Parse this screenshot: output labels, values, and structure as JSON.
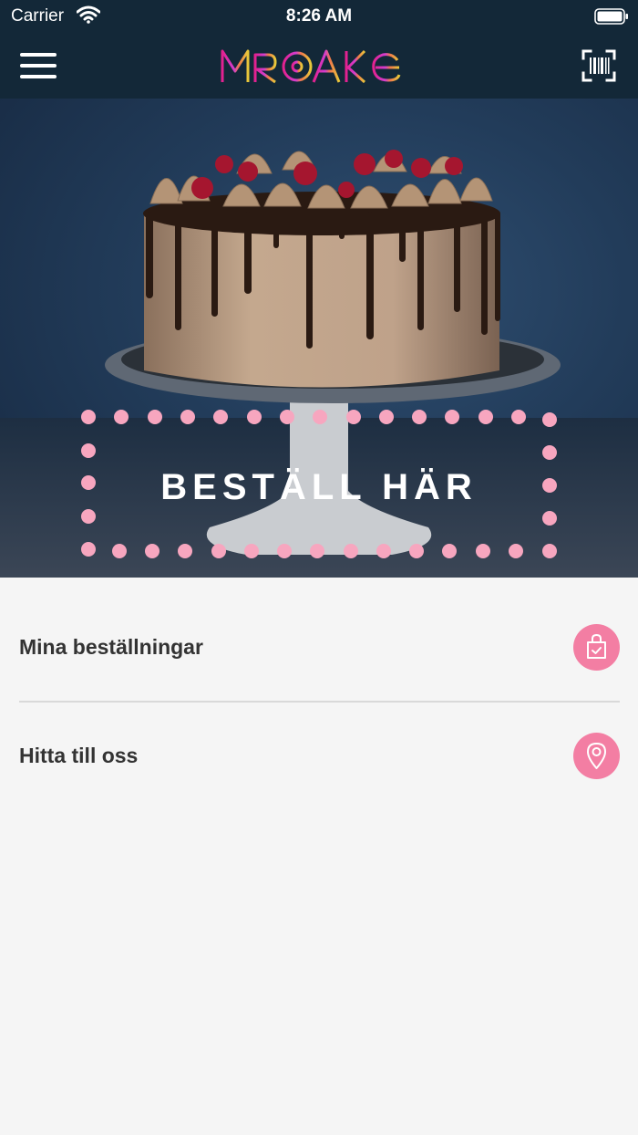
{
  "status_bar": {
    "carrier": "Carrier",
    "time": "8:26 AM"
  },
  "nav": {
    "logo_text": "MRCAKE",
    "menu_icon": "hamburger-icon",
    "scan_icon": "barcode-scan-icon"
  },
  "hero": {
    "label": "BESTÄLL HÄR"
  },
  "menu": {
    "items": [
      {
        "label": "Mina beställningar",
        "icon": "shopping-bag-icon"
      },
      {
        "label": "Hitta till oss",
        "icon": "location-pin-icon"
      }
    ]
  },
  "colors": {
    "header_bg": "#132838",
    "accent_pink": "#f37ea3",
    "dot_pink": "#f7a6bf",
    "list_bg": "#f5f5f5"
  }
}
